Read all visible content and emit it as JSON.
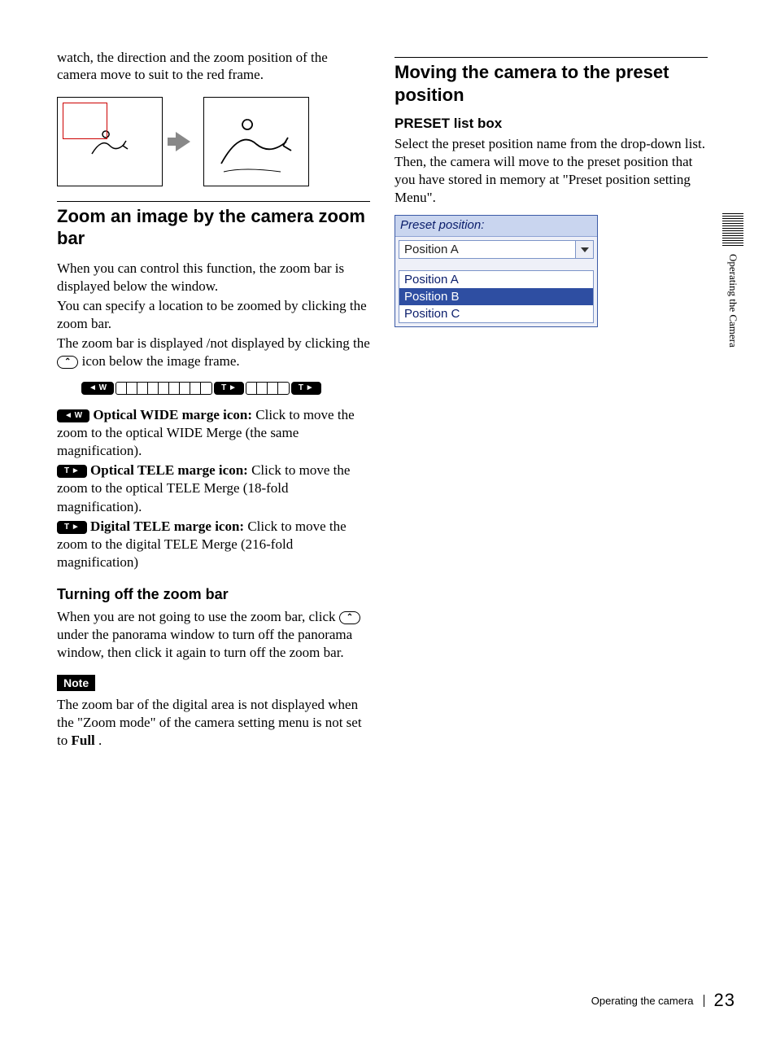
{
  "intro": "watch, the direction and the zoom position of the camera move to suit to the red frame.",
  "zoom_section": {
    "title": "Zoom an image by the camera zoom bar",
    "p1": "When you can control this function, the zoom bar is displayed below the window.",
    "p2": "You can specify a location to be zoomed by clicking the zoom bar.",
    "p3a": "The zoom bar is displayed /not displayed by clicking the",
    "p3b": " icon below the image frame.",
    "icons": {
      "optical_wide": "◄ W",
      "optical_tele": "T ►",
      "digital_tele": "T ►"
    },
    "items": {
      "ow_label": "Optical WIDE marge icon:",
      "ow_text": " Click to move the zoom to the optical WIDE Merge (the same magnification).",
      "ot_label": "Optical TELE marge icon:",
      "ot_text": " Click to move the zoom to the optical TELE Merge (18-fold magnification).",
      "dt_label": "Digital TELE marge icon:",
      "dt_text": " Click to move the zoom to the digital TELE Merge (216-fold magnification)"
    },
    "turn_off": {
      "title": "Turning off the zoom bar",
      "t1": "When you are not going to use the zoom bar, click",
      "t2": " under the panorama window to turn off the panorama window, then click it again to turn off the zoom bar."
    },
    "note_badge": "Note",
    "note_text_a": "The zoom bar of the digital area is not displayed when the \"Zoom mode\" of the camera setting menu is not set to ",
    "note_text_b": "Full",
    "note_text_c": "."
  },
  "preset_section": {
    "title": "Moving the camera to the preset position",
    "subtitle": "PRESET list box",
    "body": "Select the preset position name from the drop-down list. Then, the camera will move to the preset position that you have stored in memory at \"Preset position setting Menu\".",
    "listbox": {
      "label": "Preset position:",
      "selected": "Position A",
      "options": [
        "Position A",
        "Position B",
        "Position C"
      ],
      "highlight_index": 1
    }
  },
  "toggle_icon_label": "⌃",
  "sidebar_text": "Operating the Camera",
  "footer": {
    "section": "Operating the camera",
    "page": "23"
  }
}
